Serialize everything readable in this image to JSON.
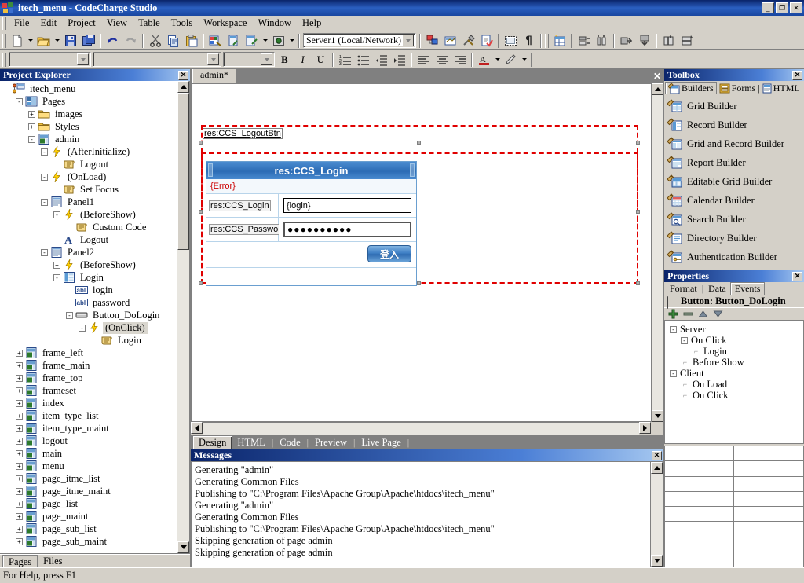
{
  "window": {
    "title": "itech_menu - CodeCharge Studio",
    "minimize": "_",
    "maximize": "❐",
    "close": "✕"
  },
  "menubar": {
    "items": [
      {
        "label": "File"
      },
      {
        "label": "Edit"
      },
      {
        "label": "Project"
      },
      {
        "label": "View"
      },
      {
        "label": "Table"
      },
      {
        "label": "Tools"
      },
      {
        "label": "Workspace"
      },
      {
        "label": "Window"
      },
      {
        "label": "Help"
      }
    ]
  },
  "toolbar": {
    "server_combo_value": "Server1 (Local/Network)",
    "style_combo_value": "",
    "font_combo_value": "",
    "size_combo_value": "",
    "format_combo_value": "",
    "bold_label": "B",
    "italic_label": "I",
    "underline_label": "U"
  },
  "project_explorer": {
    "title": "Project Explorer",
    "close_label": "✕",
    "tree": [
      {
        "label": "itech_menu",
        "indent": 0,
        "expander": "",
        "icon": "project-icon"
      },
      {
        "label": "Pages",
        "indent": 1,
        "expander": "-",
        "icon": "pages-icon"
      },
      {
        "label": "images",
        "indent": 2,
        "expander": "+",
        "icon": "folder-icon"
      },
      {
        "label": "Styles",
        "indent": 2,
        "expander": "+",
        "icon": "folder-icon"
      },
      {
        "label": "admin",
        "indent": 2,
        "expander": "-",
        "icon": "page-icon"
      },
      {
        "label": "(AfterInitialize)",
        "indent": 3,
        "expander": "-",
        "icon": "event-bolt-icon"
      },
      {
        "label": "Logout",
        "indent": 4,
        "expander": "",
        "icon": "action-scroll-icon"
      },
      {
        "label": "(OnLoad)",
        "indent": 3,
        "expander": "-",
        "icon": "event-bolt-icon"
      },
      {
        "label": "Set Focus",
        "indent": 4,
        "expander": "",
        "icon": "action-scroll-icon"
      },
      {
        "label": "Panel1",
        "indent": 3,
        "expander": "-",
        "icon": "panel-icon"
      },
      {
        "label": "(BeforeShow)",
        "indent": 4,
        "expander": "-",
        "icon": "event-bolt-icon"
      },
      {
        "label": "Custom Code",
        "indent": 5,
        "expander": "",
        "icon": "action-scroll-icon"
      },
      {
        "label": "Logout",
        "indent": 4,
        "expander": "",
        "icon": "label-a-icon"
      },
      {
        "label": "Panel2",
        "indent": 3,
        "expander": "-",
        "icon": "panel-icon"
      },
      {
        "label": "(BeforeShow)",
        "indent": 4,
        "expander": "+",
        "icon": "event-bolt-icon"
      },
      {
        "label": "Login",
        "indent": 4,
        "expander": "-",
        "icon": "record-icon"
      },
      {
        "label": "login",
        "indent": 5,
        "expander": "",
        "icon": "textbox-abl-icon"
      },
      {
        "label": "password",
        "indent": 5,
        "expander": "",
        "icon": "textbox-abl-icon"
      },
      {
        "label": "Button_DoLogin",
        "indent": 5,
        "expander": "-",
        "icon": "button-icon"
      },
      {
        "label": "(OnClick)",
        "indent": 6,
        "expander": "-",
        "icon": "event-bolt-icon",
        "selected": true
      },
      {
        "label": "Login",
        "indent": 7,
        "expander": "",
        "icon": "action-scroll-icon"
      },
      {
        "label": "frame_left",
        "indent": 1,
        "expander": "+",
        "icon": "page-icon"
      },
      {
        "label": "frame_main",
        "indent": 1,
        "expander": "+",
        "icon": "page-icon"
      },
      {
        "label": "frame_top",
        "indent": 1,
        "expander": "+",
        "icon": "page-icon"
      },
      {
        "label": "frameset",
        "indent": 1,
        "expander": "+",
        "icon": "page-icon"
      },
      {
        "label": "index",
        "indent": 1,
        "expander": "+",
        "icon": "page-icon"
      },
      {
        "label": "item_type_list",
        "indent": 1,
        "expander": "+",
        "icon": "page-icon"
      },
      {
        "label": "item_type_maint",
        "indent": 1,
        "expander": "+",
        "icon": "page-icon"
      },
      {
        "label": "logout",
        "indent": 1,
        "expander": "+",
        "icon": "page-icon"
      },
      {
        "label": "main",
        "indent": 1,
        "expander": "+",
        "icon": "page-icon"
      },
      {
        "label": "menu",
        "indent": 1,
        "expander": "+",
        "icon": "page-icon"
      },
      {
        "label": "page_itme_list",
        "indent": 1,
        "expander": "+",
        "icon": "page-icon"
      },
      {
        "label": "page_itme_maint",
        "indent": 1,
        "expander": "+",
        "icon": "page-icon"
      },
      {
        "label": "page_list",
        "indent": 1,
        "expander": "+",
        "icon": "page-icon"
      },
      {
        "label": "page_maint",
        "indent": 1,
        "expander": "+",
        "icon": "page-icon"
      },
      {
        "label": "page_sub_list",
        "indent": 1,
        "expander": "+",
        "icon": "page-icon"
      },
      {
        "label": "page_sub_maint",
        "indent": 1,
        "expander": "+",
        "icon": "page-icon"
      }
    ],
    "tabs": [
      {
        "label": "Pages",
        "active": true
      },
      {
        "label": "Files",
        "active": false
      }
    ]
  },
  "document": {
    "tab_label": "admin*",
    "close_label": "✕",
    "canvas": {
      "logout_btn_label": "res:CCS_LogoutBtn",
      "form": {
        "header": "res:CCS_Login",
        "error": "{Error}",
        "login_label": "res:CCS_Login",
        "login_value": "{login}",
        "password_label": "res:CCS_Password",
        "password_value": "●●●●●●●●●●",
        "submit_label": "登入"
      }
    },
    "view_tabs": [
      {
        "label": "Design",
        "active": true
      },
      {
        "label": "HTML",
        "active": false
      },
      {
        "label": "Code",
        "active": false
      },
      {
        "label": "Preview",
        "active": false
      },
      {
        "label": "Live Page",
        "active": false
      }
    ]
  },
  "messages": {
    "title": "Messages",
    "close_label": "✕",
    "lines": [
      "Generating \"admin\"",
      "Generating Common Files",
      "Publishing to \"C:\\Program Files\\Apache Group\\Apache\\htdocs\\itech_menu\"",
      "Generating \"admin\"",
      "Generating Common Files",
      "Publishing to \"C:\\Program Files\\Apache Group\\Apache\\htdocs\\itech_menu\"",
      "Skipping generation of page admin",
      "Skipping generation of page admin"
    ]
  },
  "toolbox": {
    "title": "Toolbox",
    "close_label": "✕",
    "tabs": [
      {
        "label": "Builders",
        "active": true
      },
      {
        "label": "Forms",
        "active": false
      },
      {
        "label": "HTML",
        "active": false
      }
    ],
    "items": [
      {
        "label": "Grid Builder"
      },
      {
        "label": "Record Builder"
      },
      {
        "label": "Grid and Record Builder"
      },
      {
        "label": "Report Builder"
      },
      {
        "label": "Editable Grid Builder"
      },
      {
        "label": "Calendar Builder"
      },
      {
        "label": "Search Builder"
      },
      {
        "label": "Directory Builder"
      },
      {
        "label": "Authentication Builder"
      }
    ]
  },
  "properties": {
    "title": "Properties",
    "close_label": "✕",
    "tabs": [
      {
        "label": "Format",
        "active": false
      },
      {
        "label": "Data",
        "active": false
      },
      {
        "label": "Events",
        "active": true
      }
    ],
    "object_label": "Button: Button_DoLogin",
    "toolbar": {
      "add": "+",
      "remove": "−",
      "move_up": "▲",
      "move_down": "▼"
    },
    "events": [
      {
        "label": "Server",
        "indent": 0,
        "expander": "-"
      },
      {
        "label": "On Click",
        "indent": 1,
        "expander": "-"
      },
      {
        "label": "Login",
        "indent": 2,
        "expander": ""
      },
      {
        "label": "Before Show",
        "indent": 1,
        "expander": ""
      },
      {
        "label": "Client",
        "indent": 0,
        "expander": "-"
      },
      {
        "label": "On Load",
        "indent": 1,
        "expander": ""
      },
      {
        "label": "On Click",
        "indent": 1,
        "expander": ""
      }
    ],
    "grid_rows": 8
  },
  "statusbar": {
    "text": "For Help, press F1"
  },
  "colors": {
    "titlebar_start": "#0a246a",
    "accent_blue": "#2c6cb5",
    "dashed_red": "#e00000",
    "chrome": "#d4d0c8",
    "error_red": "#cc0000"
  }
}
